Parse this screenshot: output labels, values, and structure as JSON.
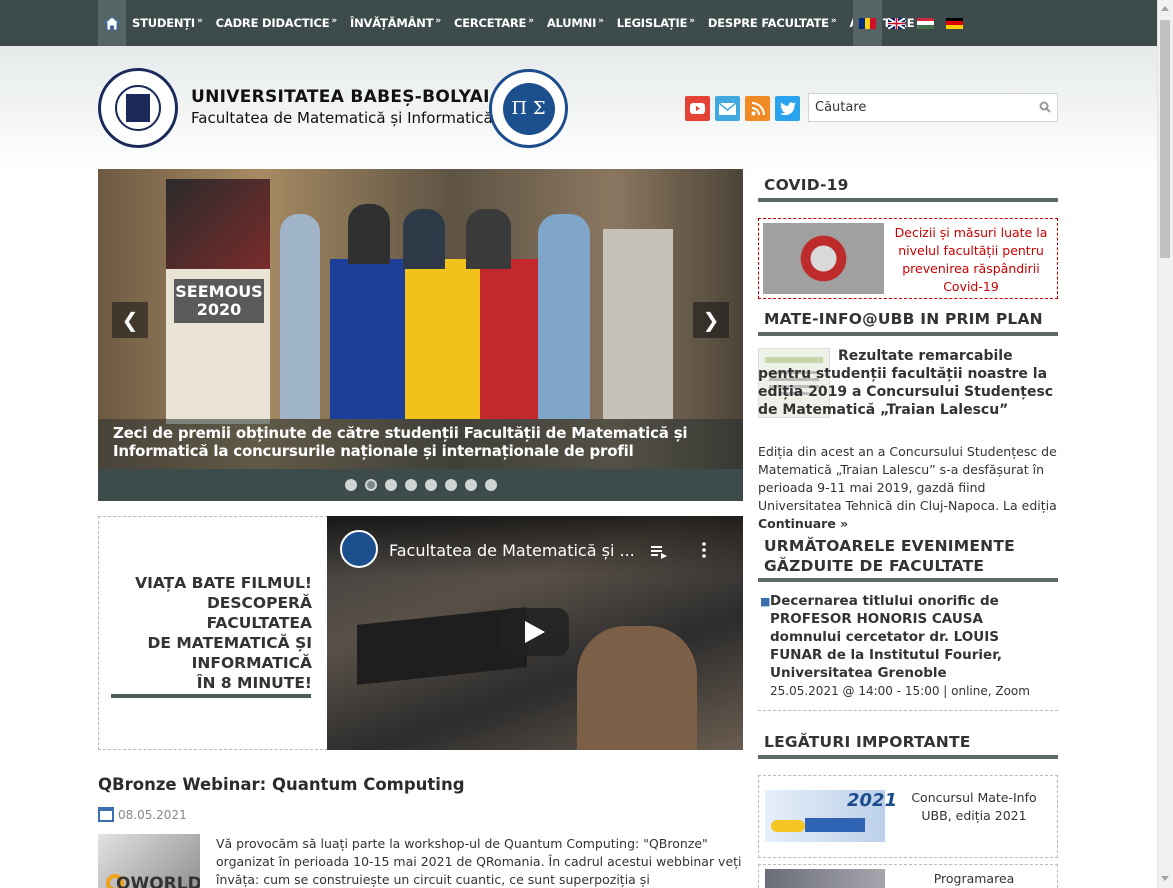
{
  "nav": {
    "items": [
      {
        "label": "STUDENȚI",
        "arrow": "»"
      },
      {
        "label": "CADRE DIDACTICE",
        "arrow": "»"
      },
      {
        "label": "ÎNVĂȚĂMÂNT",
        "arrow": "»"
      },
      {
        "label": "CERCETARE",
        "arrow": "»"
      },
      {
        "label": "ALUMNI",
        "arrow": "»"
      },
      {
        "label": "LEGISLAȚIE",
        "arrow": "»"
      },
      {
        "label": "DESPRE FACULTATE",
        "arrow": "»"
      },
      {
        "label": "ADMITERE",
        "arrow": "»"
      }
    ],
    "languages": [
      "ro",
      "en",
      "hu",
      "de"
    ]
  },
  "header": {
    "university": "UNIVERSITATEA BABEȘ-BOLYAI",
    "faculty": "Facultatea de Matematică și Informatică",
    "search_placeholder": "Căutare"
  },
  "slider": {
    "caption": "Zeci de premii obținute de către studenții Facultății de Matematică și Informatică la concursurile naționale și internaționale de profil",
    "photo_banner": "SEEMOUS 2020",
    "dot_count": 8,
    "active_dot": 1
  },
  "video": {
    "promo": [
      "VIAȚA BATE FILMUL!",
      "DESCOPERĂ",
      "FACULTATEA",
      "DE MATEMATICĂ ȘI",
      "INFORMATICĂ",
      "ÎN 8 MINUTE!"
    ],
    "title": "Facultatea de Matematică și ..."
  },
  "article": {
    "title": "QBronze Webinar: Quantum Computing",
    "date": "08.05.2021",
    "image_text": "QWORLD",
    "text": "Vă provocăm să luați parte la workshop-ul de Quantum Computing: \"QBronze\" organizat în perioada 10-15  mai 2021 de QRomania. În cadrul acestui webbinar veți învăța: cum se construiește un circuit cuantic, ce sunt superpoziția și entanglement-ul și cum le"
  },
  "sidebar": {
    "covid": {
      "heading": "COVID-19",
      "text": "Decizii și măsuri luate la nivelul facultății pentru prevenirea răspândirii Covid-19"
    },
    "featured": {
      "heading": "MATE-INFO@UBB IN PRIM PLAN",
      "title": "Rezultate remarcabile pentru studenții facultății noastre la ediția 2019 a Concursului Studențesc de Matematică „Traian Lalescu”",
      "text": "Ediția din acest an a Concursului Studențesc de Matematică „Traian Lalescu” s-a desfășurat în perioada 9-11 mai 2019, gazdă fiind Universitatea Tehnică din Cluj-Napoca. La ediția",
      "more": "Continuare »"
    },
    "events": {
      "heading_line1": "URMĂTOARELE EVENIMENTE",
      "heading_line2": "GĂZDUITE DE FACULTATE",
      "item_title": "Decernarea titlului onorific de PROFESOR HONORIS CAUSA domnului cercetator dr. LOUIS FUNAR de la Institutul Fourier, Universitatea Grenoble",
      "item_when": "25.05.2021 @ 14:00 - 15:00 | online, Zoom"
    },
    "links": {
      "heading": "LEGĂTURI IMPORTANTE",
      "item1": "Concursul Mate-Info UBB, ediția 2021",
      "item1_img": "2021",
      "item2": "Programarea consultațiilor"
    }
  },
  "colors": {
    "nav_bg": "#3d4b4b",
    "accent_bar": "#5c6a6a",
    "covid_red": "#cc0000",
    "link_blue": "#3a6fb0"
  }
}
